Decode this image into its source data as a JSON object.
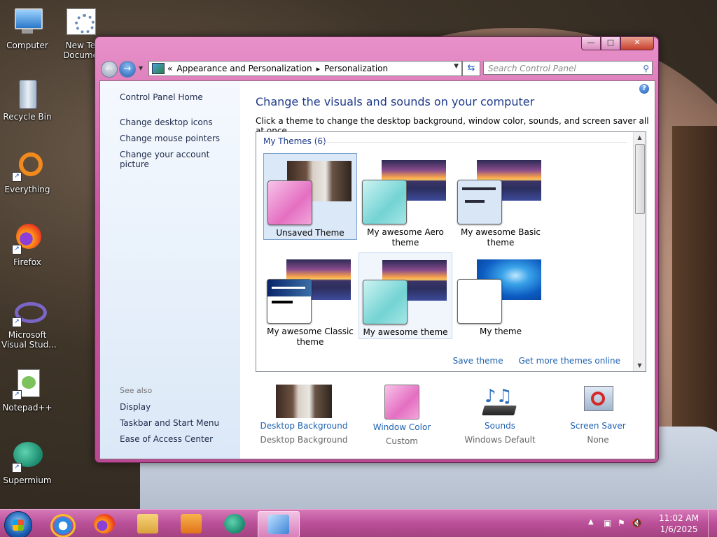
{
  "desktop_icons": [
    {
      "label": "Computer",
      "icon": "computer-icon"
    },
    {
      "label": "New Te\nDocume",
      "icon": "text-document-icon"
    },
    {
      "label": "Recycle Bin",
      "icon": "recycle-bin-icon"
    },
    {
      "label": "Everything",
      "icon": "everything-search-icon"
    },
    {
      "label": "Firefox",
      "icon": "firefox-icon"
    },
    {
      "label": "Microsoft\nVisual Stud...",
      "icon": "visual-studio-icon"
    },
    {
      "label": "Notepad++",
      "icon": "notepad-plus-plus-icon"
    },
    {
      "label": "Supermium",
      "icon": "supermium-icon"
    }
  ],
  "window": {
    "caption_buttons": {
      "minimize": "—",
      "maximize": "□",
      "close": "✕"
    },
    "nav": {
      "back": "←",
      "forward": "→"
    },
    "breadcrumb": {
      "prefix": "«",
      "items": [
        "Appearance and Personalization",
        "Personalization"
      ],
      "separator": "▸"
    },
    "search": {
      "placeholder": "Search Control Panel"
    },
    "left_pane": {
      "links": [
        "Control Panel Home",
        "Change desktop icons",
        "Change mouse pointers",
        "Change your account picture"
      ],
      "see_also_label": "See also",
      "see_also": [
        "Display",
        "Taskbar and Start Menu",
        "Ease of Access Center"
      ]
    },
    "heading": "Change the visuals and sounds on your computer",
    "subtext": "Click a theme to change the desktop background, window color, sounds, and screen saver all at once.",
    "themes_group": "My Themes (6)",
    "themes": [
      {
        "name": "Unsaved Theme",
        "state": "selected",
        "photo": "man",
        "swatch": "pink"
      },
      {
        "name": "My awesome Aero theme",
        "state": "normal",
        "photo": "sunset",
        "swatch": "aqua"
      },
      {
        "name": "My awesome Basic theme",
        "state": "normal",
        "photo": "sunset",
        "swatch": "basic"
      },
      {
        "name": "My awesome Classic theme",
        "state": "normal",
        "photo": "sunset",
        "swatch": "classic"
      },
      {
        "name": "My awesome theme",
        "state": "hover",
        "photo": "sunset",
        "swatch": "aqua"
      },
      {
        "name": "My theme",
        "state": "normal",
        "photo": "win7",
        "swatch": "white"
      }
    ],
    "save_theme": "Save theme",
    "get_more": "Get more themes online",
    "bottom": [
      {
        "link": "Desktop Background",
        "value": "Desktop Background",
        "icon": "desktop-background-thumbnail"
      },
      {
        "link": "Window Color",
        "value": "Custom",
        "icon": "window-color-swatch"
      },
      {
        "link": "Sounds",
        "value": "Windows Default",
        "icon": "music-notes-icon"
      },
      {
        "link": "Screen Saver",
        "value": "None",
        "icon": "screen-saver-icon"
      }
    ]
  },
  "taskbar": {
    "pinned": [
      "internet-explorer-icon",
      "firefox-icon",
      "file-explorer-icon",
      "media-player-icon",
      "supermium-icon",
      "control-panel-icon"
    ],
    "time": "11:02 AM",
    "date": "1/6/2025"
  },
  "colors": {
    "accent": "#c7569f",
    "link": "#1e62b0",
    "heading": "#1e3a8a"
  }
}
